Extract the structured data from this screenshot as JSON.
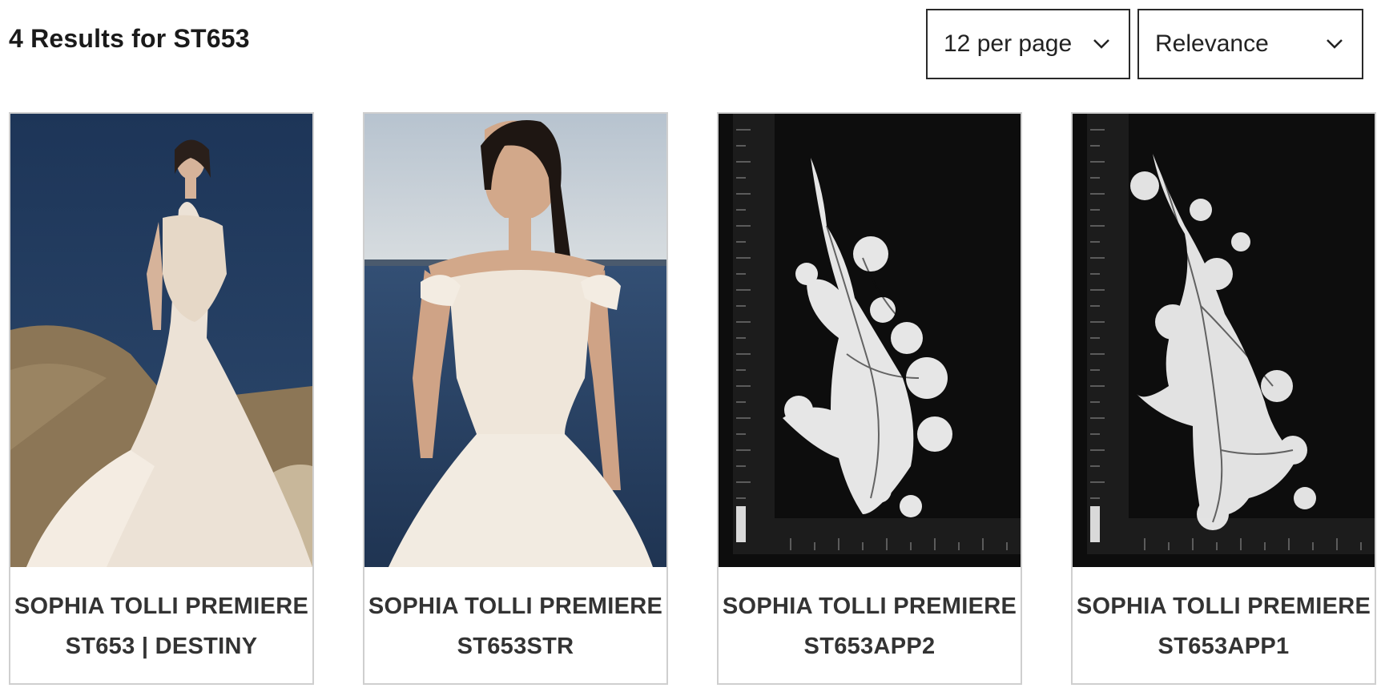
{
  "header": {
    "results_title": "4 Results for ST653"
  },
  "controls": {
    "per_page": {
      "selected": "12 per page"
    },
    "sort": {
      "selected": "Relevance"
    }
  },
  "products": [
    {
      "brand": "SOPHIA TOLLI PREMIERE",
      "style": "ST653 | DESTINY"
    },
    {
      "brand": "SOPHIA TOLLI PREMIERE",
      "style": "ST653STR"
    },
    {
      "brand": "SOPHIA TOLLI PREMIERE",
      "style": "ST653APP2"
    },
    {
      "brand": "SOPHIA TOLLI PREMIERE",
      "style": "ST653APP1"
    }
  ],
  "colors": {
    "text": "#1f1f1f",
    "border": "#cfcfcf",
    "control_border": "#2a2a2a"
  }
}
